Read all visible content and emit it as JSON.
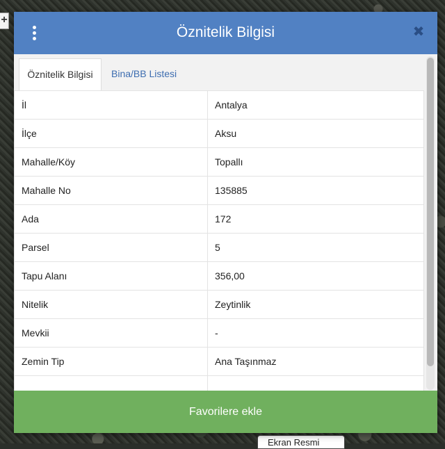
{
  "map": {
    "zoom_label": "+",
    "bottom_tab_label": "Ekran Resmi"
  },
  "modal": {
    "title": "Öznitelik Bilgisi",
    "close_symbol": "✖",
    "tabs": [
      {
        "label": "Öznitelik Bilgisi",
        "active": true
      },
      {
        "label": "Bina/BB Listesi",
        "active": false
      }
    ],
    "rows": [
      {
        "key": "İl",
        "value": "Antalya"
      },
      {
        "key": "İlçe",
        "value": "Aksu"
      },
      {
        "key": "Mahalle/Köy",
        "value": "Topallı"
      },
      {
        "key": "Mahalle No",
        "value": "135885"
      },
      {
        "key": "Ada",
        "value": "172"
      },
      {
        "key": "Parsel",
        "value": "5"
      },
      {
        "key": "Tapu Alanı",
        "value": "356,00"
      },
      {
        "key": "Nitelik",
        "value": "Zeytinlik"
      },
      {
        "key": "Mevkii",
        "value": "-"
      },
      {
        "key": "Zemin Tip",
        "value": "Ana Taşınmaz"
      },
      {
        "key": "",
        "value": ""
      }
    ],
    "favorite_button_label": "Favorilere ekle"
  },
  "colors": {
    "header_bg": "#5181c3",
    "button_bg": "#70b05e",
    "tab_link": "#3d6db0"
  }
}
